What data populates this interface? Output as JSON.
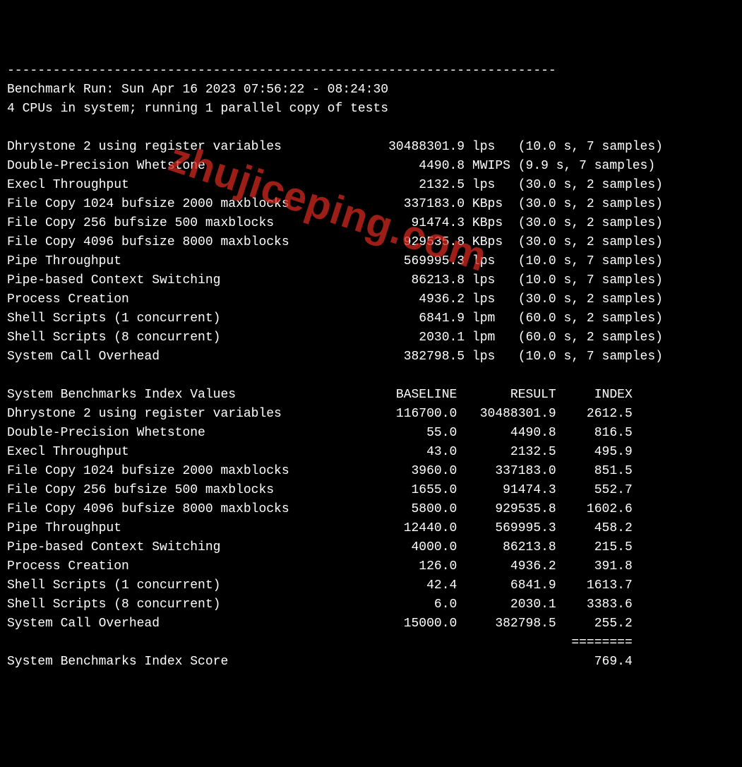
{
  "header": {
    "dash_line": "------------------------------------------------------------------------",
    "run_line": "Benchmark Run: Sun Apr 16 2023 07:56:22 - 08:24:30",
    "cpu_line": "4 CPUs in system; running 1 parallel copy of tests"
  },
  "tests": [
    {
      "name": "Dhrystone 2 using register variables",
      "value": "30488301.9",
      "unit": "lps",
      "dur": "10.0",
      "samples": "7"
    },
    {
      "name": "Double-Precision Whetstone",
      "value": "4490.8",
      "unit": "MWIPS",
      "dur": "9.9",
      "samples": "7"
    },
    {
      "name": "Execl Throughput",
      "value": "2132.5",
      "unit": "lps",
      "dur": "30.0",
      "samples": "2"
    },
    {
      "name": "File Copy 1024 bufsize 2000 maxblocks",
      "value": "337183.0",
      "unit": "KBps",
      "dur": "30.0",
      "samples": "2"
    },
    {
      "name": "File Copy 256 bufsize 500 maxblocks",
      "value": "91474.3",
      "unit": "KBps",
      "dur": "30.0",
      "samples": "2"
    },
    {
      "name": "File Copy 4096 bufsize 8000 maxblocks",
      "value": "929535.8",
      "unit": "KBps",
      "dur": "30.0",
      "samples": "2"
    },
    {
      "name": "Pipe Throughput",
      "value": "569995.3",
      "unit": "lps",
      "dur": "10.0",
      "samples": "7"
    },
    {
      "name": "Pipe-based Context Switching",
      "value": "86213.8",
      "unit": "lps",
      "dur": "10.0",
      "samples": "7"
    },
    {
      "name": "Process Creation",
      "value": "4936.2",
      "unit": "lps",
      "dur": "30.0",
      "samples": "2"
    },
    {
      "name": "Shell Scripts (1 concurrent)",
      "value": "6841.9",
      "unit": "lpm",
      "dur": "60.0",
      "samples": "2"
    },
    {
      "name": "Shell Scripts (8 concurrent)",
      "value": "2030.1",
      "unit": "lpm",
      "dur": "60.0",
      "samples": "2"
    },
    {
      "name": "System Call Overhead",
      "value": "382798.5",
      "unit": "lps",
      "dur": "10.0",
      "samples": "7"
    }
  ],
  "index_header": {
    "title": "System Benchmarks Index Values",
    "c1": "BASELINE",
    "c2": "RESULT",
    "c3": "INDEX"
  },
  "index_rows": [
    {
      "name": "Dhrystone 2 using register variables",
      "baseline": "116700.0",
      "result": "30488301.9",
      "index": "2612.5"
    },
    {
      "name": "Double-Precision Whetstone",
      "baseline": "55.0",
      "result": "4490.8",
      "index": "816.5"
    },
    {
      "name": "Execl Throughput",
      "baseline": "43.0",
      "result": "2132.5",
      "index": "495.9"
    },
    {
      "name": "File Copy 1024 bufsize 2000 maxblocks",
      "baseline": "3960.0",
      "result": "337183.0",
      "index": "851.5"
    },
    {
      "name": "File Copy 256 bufsize 500 maxblocks",
      "baseline": "1655.0",
      "result": "91474.3",
      "index": "552.7"
    },
    {
      "name": "File Copy 4096 bufsize 8000 maxblocks",
      "baseline": "5800.0",
      "result": "929535.8",
      "index": "1602.6"
    },
    {
      "name": "Pipe Throughput",
      "baseline": "12440.0",
      "result": "569995.3",
      "index": "458.2"
    },
    {
      "name": "Pipe-based Context Switching",
      "baseline": "4000.0",
      "result": "86213.8",
      "index": "215.5"
    },
    {
      "name": "Process Creation",
      "baseline": "126.0",
      "result": "4936.2",
      "index": "391.8"
    },
    {
      "name": "Shell Scripts (1 concurrent)",
      "baseline": "42.4",
      "result": "6841.9",
      "index": "1613.7"
    },
    {
      "name": "Shell Scripts (8 concurrent)",
      "baseline": "6.0",
      "result": "2030.1",
      "index": "3383.6"
    },
    {
      "name": "System Call Overhead",
      "baseline": "15000.0",
      "result": "382798.5",
      "index": "255.2"
    }
  ],
  "footer": {
    "divider": "========",
    "label": "System Benchmarks Index Score",
    "score": "769.4"
  },
  "watermark": "zhujiceping.com"
}
